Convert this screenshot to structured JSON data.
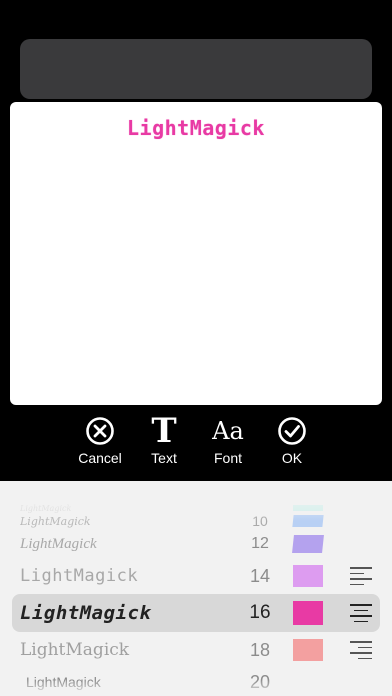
{
  "preview": {
    "text": "LightMagick",
    "color": "#e83aa4"
  },
  "toolbar": {
    "cancel": {
      "label": "Cancel",
      "icon": "cancel-circle-icon"
    },
    "text": {
      "label": "Text",
      "icon": "text-T-icon",
      "glyph": "T"
    },
    "font": {
      "label": "Font",
      "icon": "font-Aa-icon",
      "glyph": "Aa"
    },
    "ok": {
      "label": "OK",
      "icon": "check-circle-icon"
    }
  },
  "rows": [
    {
      "name": "LightMagick",
      "size": "",
      "color": "#d0f0ec",
      "align": ""
    },
    {
      "name": "LightMagick",
      "size": "10",
      "color": "#b8d0f4",
      "align": ""
    },
    {
      "name": "LightMagick",
      "size": "12",
      "color": "#b4a2ee",
      "align": ""
    },
    {
      "name": "LightMagick",
      "size": "14",
      "color": "#dd9cf0",
      "align": "left"
    },
    {
      "name": "LightMagick",
      "size": "16",
      "color": "#e83aa4",
      "align": "center"
    },
    {
      "name": "LightMagick",
      "size": "18",
      "color": "#f3a0a0",
      "align": "right"
    },
    {
      "name": "LightMagick",
      "size": "20",
      "color": "",
      "align": ""
    }
  ]
}
